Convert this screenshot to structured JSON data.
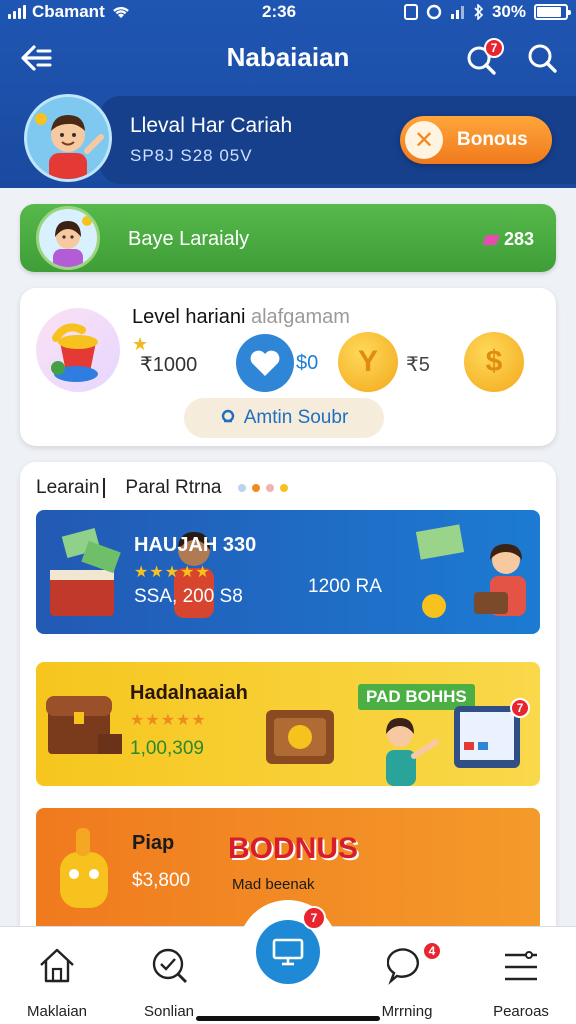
{
  "status_bar": {
    "carrier": "Cbamant",
    "time": "2:36",
    "battery": "30%"
  },
  "header": {
    "title": "Nabaiaian",
    "notification_count": "7"
  },
  "user": {
    "name": "Lleval Har Cariah",
    "subtitle": "SP8J S28 05V",
    "bonus_label": "Bonous"
  },
  "green_banner": {
    "label": "Baye Laraialy",
    "value": "283"
  },
  "level_card": {
    "title": "Level hariani",
    "title_hint": "alafgamam",
    "amount": "1000",
    "value_1": "$0",
    "value_2": "5",
    "amount_button": "Amtin Soubr"
  },
  "list": {
    "tabs": [
      "Learain",
      "Paral Rtrna"
    ],
    "promos": [
      {
        "title": "HAUJAH 330",
        "sub": "SSA, 200 S8",
        "extra": "1200 RA"
      },
      {
        "title": "Hadalnaaiah",
        "sub": "1,00,309",
        "extra": "PAD BOHHS",
        "badge": "7"
      },
      {
        "title": "Piap",
        "sub": "3,800",
        "extra": "BODNUS",
        "extra_sub": "Mad beenak"
      }
    ]
  },
  "nav": {
    "items": [
      {
        "label": "Maklaian",
        "icon": "home-icon"
      },
      {
        "label": "Sonlian",
        "icon": "search-check-icon"
      },
      {
        "label": "Mrrning",
        "icon": "chat-icon",
        "badge": "4"
      },
      {
        "label": "Pearoas",
        "icon": "menu-icon"
      }
    ],
    "fab_badge": "7"
  },
  "colors": {
    "primary": "#1f56b3",
    "accent_orange": "#f07a1d",
    "green": "#4caf43",
    "badge_red": "#e8252f"
  }
}
